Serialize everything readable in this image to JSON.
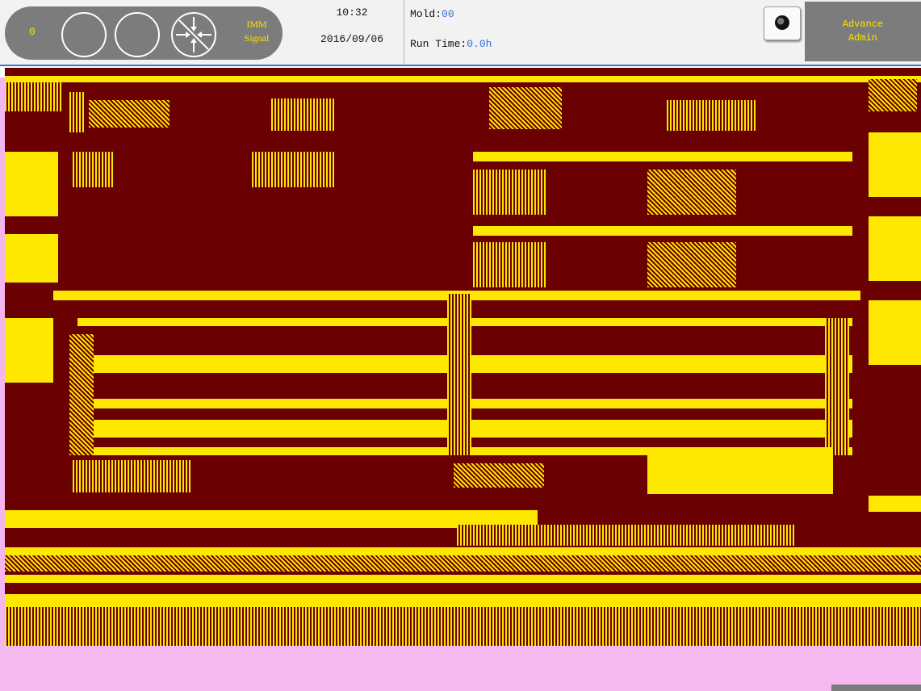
{
  "header": {
    "count": "0",
    "signal_label_line1": "IMM",
    "signal_label_line2": "Signal",
    "time": "10:32",
    "date": "2016/09/06",
    "mold_label": "Mold:",
    "mold_value": "00",
    "runtime_label": "Run Time:",
    "runtime_value": "0.0h",
    "user_line1": "Advance",
    "user_line2": "Admin"
  },
  "icons": {
    "status_circle_1": "status-light-icon",
    "status_circle_2": "status-light-icon",
    "signal": "imm-signal-icon",
    "camera": "camera-icon"
  },
  "colors": {
    "accent_yellow": "#ffe200",
    "header_gray": "#7c7c7c",
    "corrupted_background": "#6b0000",
    "corrupted_foreground": "#ffe800",
    "corrupted_strip": "#f3b6ee"
  }
}
